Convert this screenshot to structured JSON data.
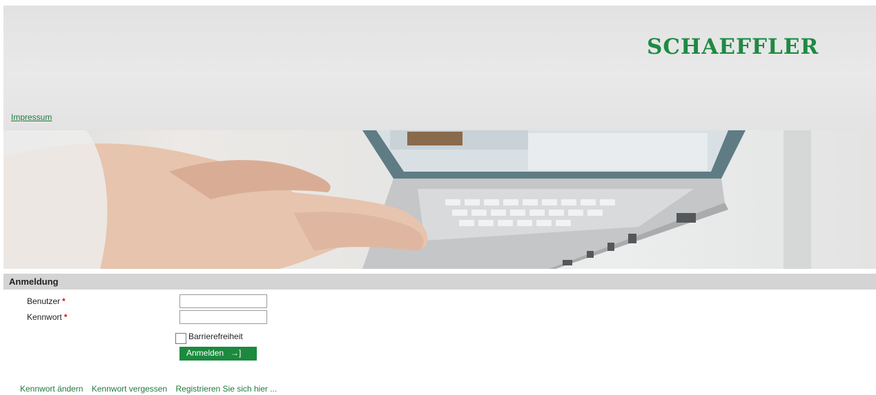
{
  "header": {
    "logo_text": "SCHAEFFLER",
    "impressum_link": "Impressum",
    "brand_color": "#1f8a44"
  },
  "hero": {
    "image_alt": "hands-typing-on-laptop"
  },
  "login": {
    "section_title": "Anmeldung",
    "user_label": "Benutzer",
    "password_label": "Kennwort",
    "required_marker": "*",
    "user_value": "",
    "password_value": "",
    "accessibility_label": "Barrierefreiheit",
    "accessibility_checked": false,
    "submit_label": "Anmelden",
    "submit_icon": "login-arrow-icon",
    "submit_glyph": "→]"
  },
  "footer_links": {
    "change_password": "Kennwort ändern",
    "forgot_password": "Kennwort vergessen",
    "register": "Registrieren Sie sich hier ..."
  }
}
